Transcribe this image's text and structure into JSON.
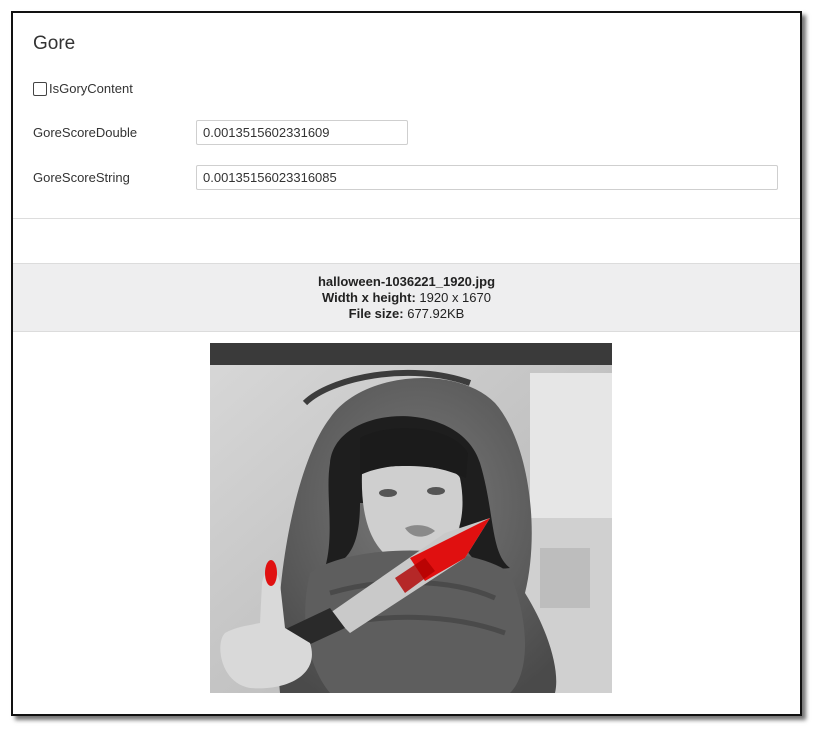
{
  "panel": {
    "title": "Gore",
    "is_gory_content": {
      "label": "IsGoryContent",
      "checked": false
    },
    "gore_score_double": {
      "label": "GoreScoreDouble",
      "value": "0.0013515602331609"
    },
    "gore_score_string": {
      "label": "GoreScoreString",
      "value": "0.00135156023316085"
    }
  },
  "file_info": {
    "filename": "halloween-1036221_1920.jpg",
    "dimensions_label": "Width x height:",
    "dimensions_value": "1920 x 1670",
    "size_label": "File size:",
    "size_value": "677.92KB"
  },
  "image": {
    "subject": "grayscale photo of hooded woman holding knife with red-tinted blade near her mouth",
    "accent_color": "#e01010"
  }
}
